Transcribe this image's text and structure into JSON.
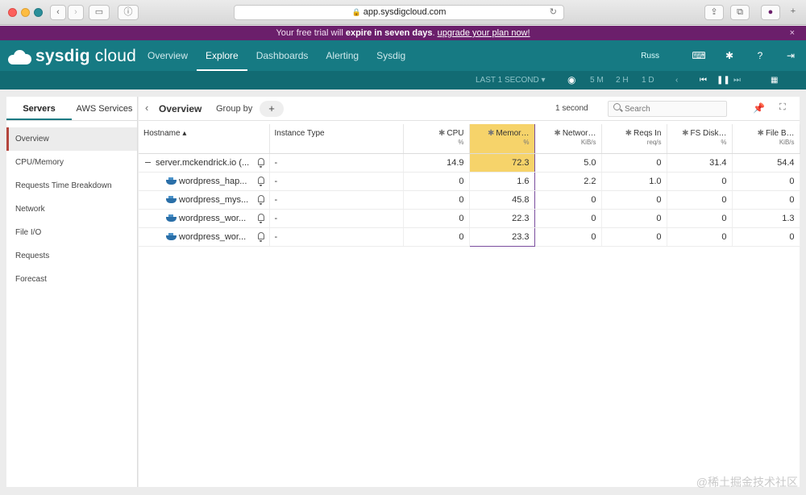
{
  "browser": {
    "url": "app.sysdigcloud.com"
  },
  "trial_banner": {
    "prefix": "Your free trial will ",
    "emphasis": "expire in seven days",
    "separator": ". ",
    "link": "upgrade your plan now!",
    "close": "×"
  },
  "app": {
    "logo_bold": "sysdig",
    "logo_light": " cloud",
    "nav": [
      "Overview",
      "Explore",
      "Dashboards",
      "Alerting",
      "Sysdig"
    ],
    "active_nav": "Explore",
    "user": "Russ",
    "timebar": {
      "range": "LAST 1 SECOND ▾",
      "t1": "5 M",
      "t2": "2 H",
      "t3": "1 D"
    }
  },
  "sidebar": {
    "tabs": [
      "Servers",
      "AWS Services"
    ],
    "items": [
      "Overview",
      "CPU/Memory",
      "Requests Time Breakdown",
      "Network",
      "File I/O",
      "Requests",
      "Forecast"
    ]
  },
  "toolbar": {
    "title": "Overview",
    "group_by": "Group by",
    "plus": "+",
    "interval": "1 second",
    "search_placeholder": "Search"
  },
  "table": {
    "headers": [
      {
        "label": "Hostname ▴",
        "unit": ""
      },
      {
        "label": "Instance Type",
        "unit": ""
      },
      {
        "label": "CPU",
        "unit": "%"
      },
      {
        "label": "Memor…",
        "unit": "%"
      },
      {
        "label": "Networ…",
        "unit": "KiB/s"
      },
      {
        "label": "Reqs In",
        "unit": "req/s"
      },
      {
        "label": "FS Disk…",
        "unit": "%"
      },
      {
        "label": "File B…",
        "unit": "KiB/s"
      }
    ],
    "rows": [
      {
        "host": "server.mckendrick.io (...",
        "instance": "-",
        "cpu": "14.9",
        "mem": "72.3",
        "net": "5.0",
        "reqs": "0",
        "fs": "31.4",
        "file": "54.4"
      },
      {
        "host": "wordpress_hap...",
        "instance": "-",
        "cpu": "0",
        "mem": "1.6",
        "net": "2.2",
        "reqs": "1.0",
        "fs": "0",
        "file": "0"
      },
      {
        "host": "wordpress_mys...",
        "instance": "-",
        "cpu": "0",
        "mem": "45.8",
        "net": "0",
        "reqs": "0",
        "fs": "0",
        "file": "0"
      },
      {
        "host": "wordpress_wor...",
        "instance": "-",
        "cpu": "0",
        "mem": "22.3",
        "net": "0",
        "reqs": "0",
        "fs": "0",
        "file": "1.3"
      },
      {
        "host": "wordpress_wor...",
        "instance": "-",
        "cpu": "0",
        "mem": "23.3",
        "net": "0",
        "reqs": "0",
        "fs": "0",
        "file": "0"
      }
    ]
  },
  "watermark": "@稀土掘金技术社区",
  "colors": {
    "header": "#167a83",
    "trial_banner": "#6b1f6b",
    "highlight": "#f6d36a",
    "selection": "#7a4d9e"
  }
}
